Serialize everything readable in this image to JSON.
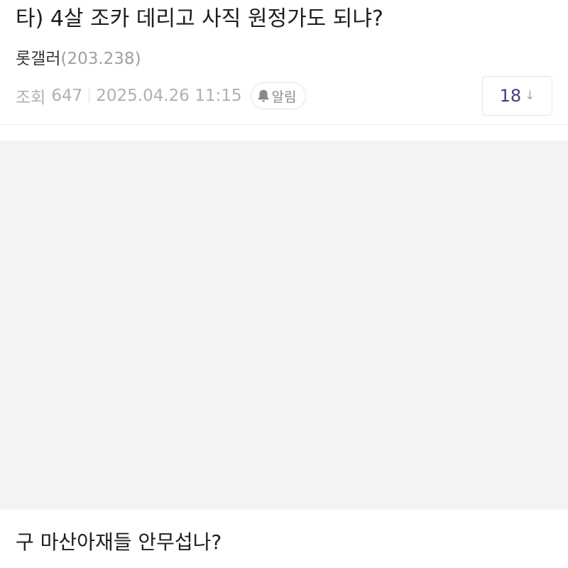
{
  "post": {
    "title": "타) 4살 조카 데리고 사직 원정가도 되냐?",
    "author": {
      "name": "롯갤러",
      "score": "(203.238)"
    },
    "meta": {
      "views_label": "조회",
      "views": "647",
      "datetime": "2025.04.26 11:15",
      "alarm_label": "알림",
      "alarm_icon": "bell-icon"
    },
    "comment_count": "18",
    "comment_arrow": "↓",
    "body_text": "구 마산아재들 안무섭나?"
  },
  "colors": {
    "title": "#1e1e1e",
    "meta": "#b0b0b0",
    "comment_count": "#3b3f86",
    "placeholder": "#f3f3f3"
  }
}
